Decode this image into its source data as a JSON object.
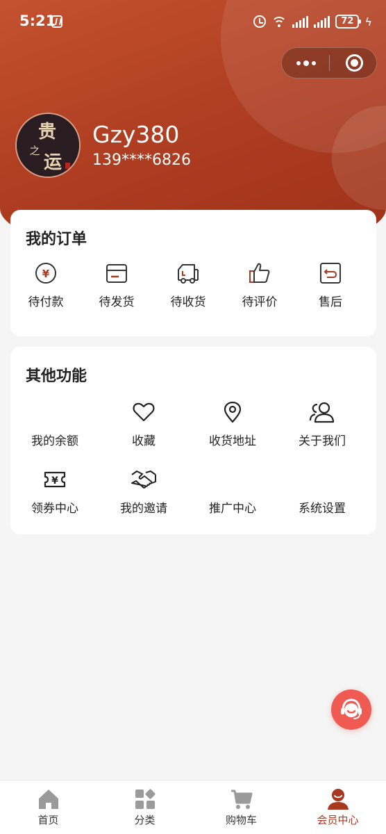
{
  "status_bar": {
    "time": "5:21",
    "battery": "72"
  },
  "profile": {
    "username": "Gzy380",
    "phone": "139****6826",
    "avatar_text": "贵之运"
  },
  "orders": {
    "title": "我的订单",
    "items": [
      {
        "label": "待付款",
        "icon": "yen-circle-icon"
      },
      {
        "label": "待发货",
        "icon": "package-box-icon"
      },
      {
        "label": "待收货",
        "icon": "delivery-truck-icon"
      },
      {
        "label": "待评价",
        "icon": "thumbs-up-icon"
      },
      {
        "label": "售后",
        "icon": "return-arrow-icon"
      }
    ]
  },
  "other": {
    "title": "其他功能",
    "items": [
      {
        "label": "我的余额",
        "icon": ""
      },
      {
        "label": "收藏",
        "icon": "heart-icon"
      },
      {
        "label": "收货地址",
        "icon": "location-pin-icon"
      },
      {
        "label": "关于我们",
        "icon": "users-icon"
      },
      {
        "label": "领券中心",
        "icon": "coupon-ticket-icon"
      },
      {
        "label": "我的邀请",
        "icon": "handshake-icon"
      },
      {
        "label": "推广中心",
        "icon": ""
      },
      {
        "label": "系统设置",
        "icon": ""
      }
    ]
  },
  "tabbar": {
    "items": [
      {
        "label": "首页",
        "icon": "home-icon"
      },
      {
        "label": "分类",
        "icon": "category-icon"
      },
      {
        "label": "购物车",
        "icon": "cart-icon"
      },
      {
        "label": "会员中心",
        "icon": "member-icon"
      }
    ],
    "active_index": 3
  },
  "colors": {
    "brand": "#a8381e",
    "header_start": "#c4512f",
    "header_end": "#9c3018",
    "service": "#ef5a53"
  }
}
